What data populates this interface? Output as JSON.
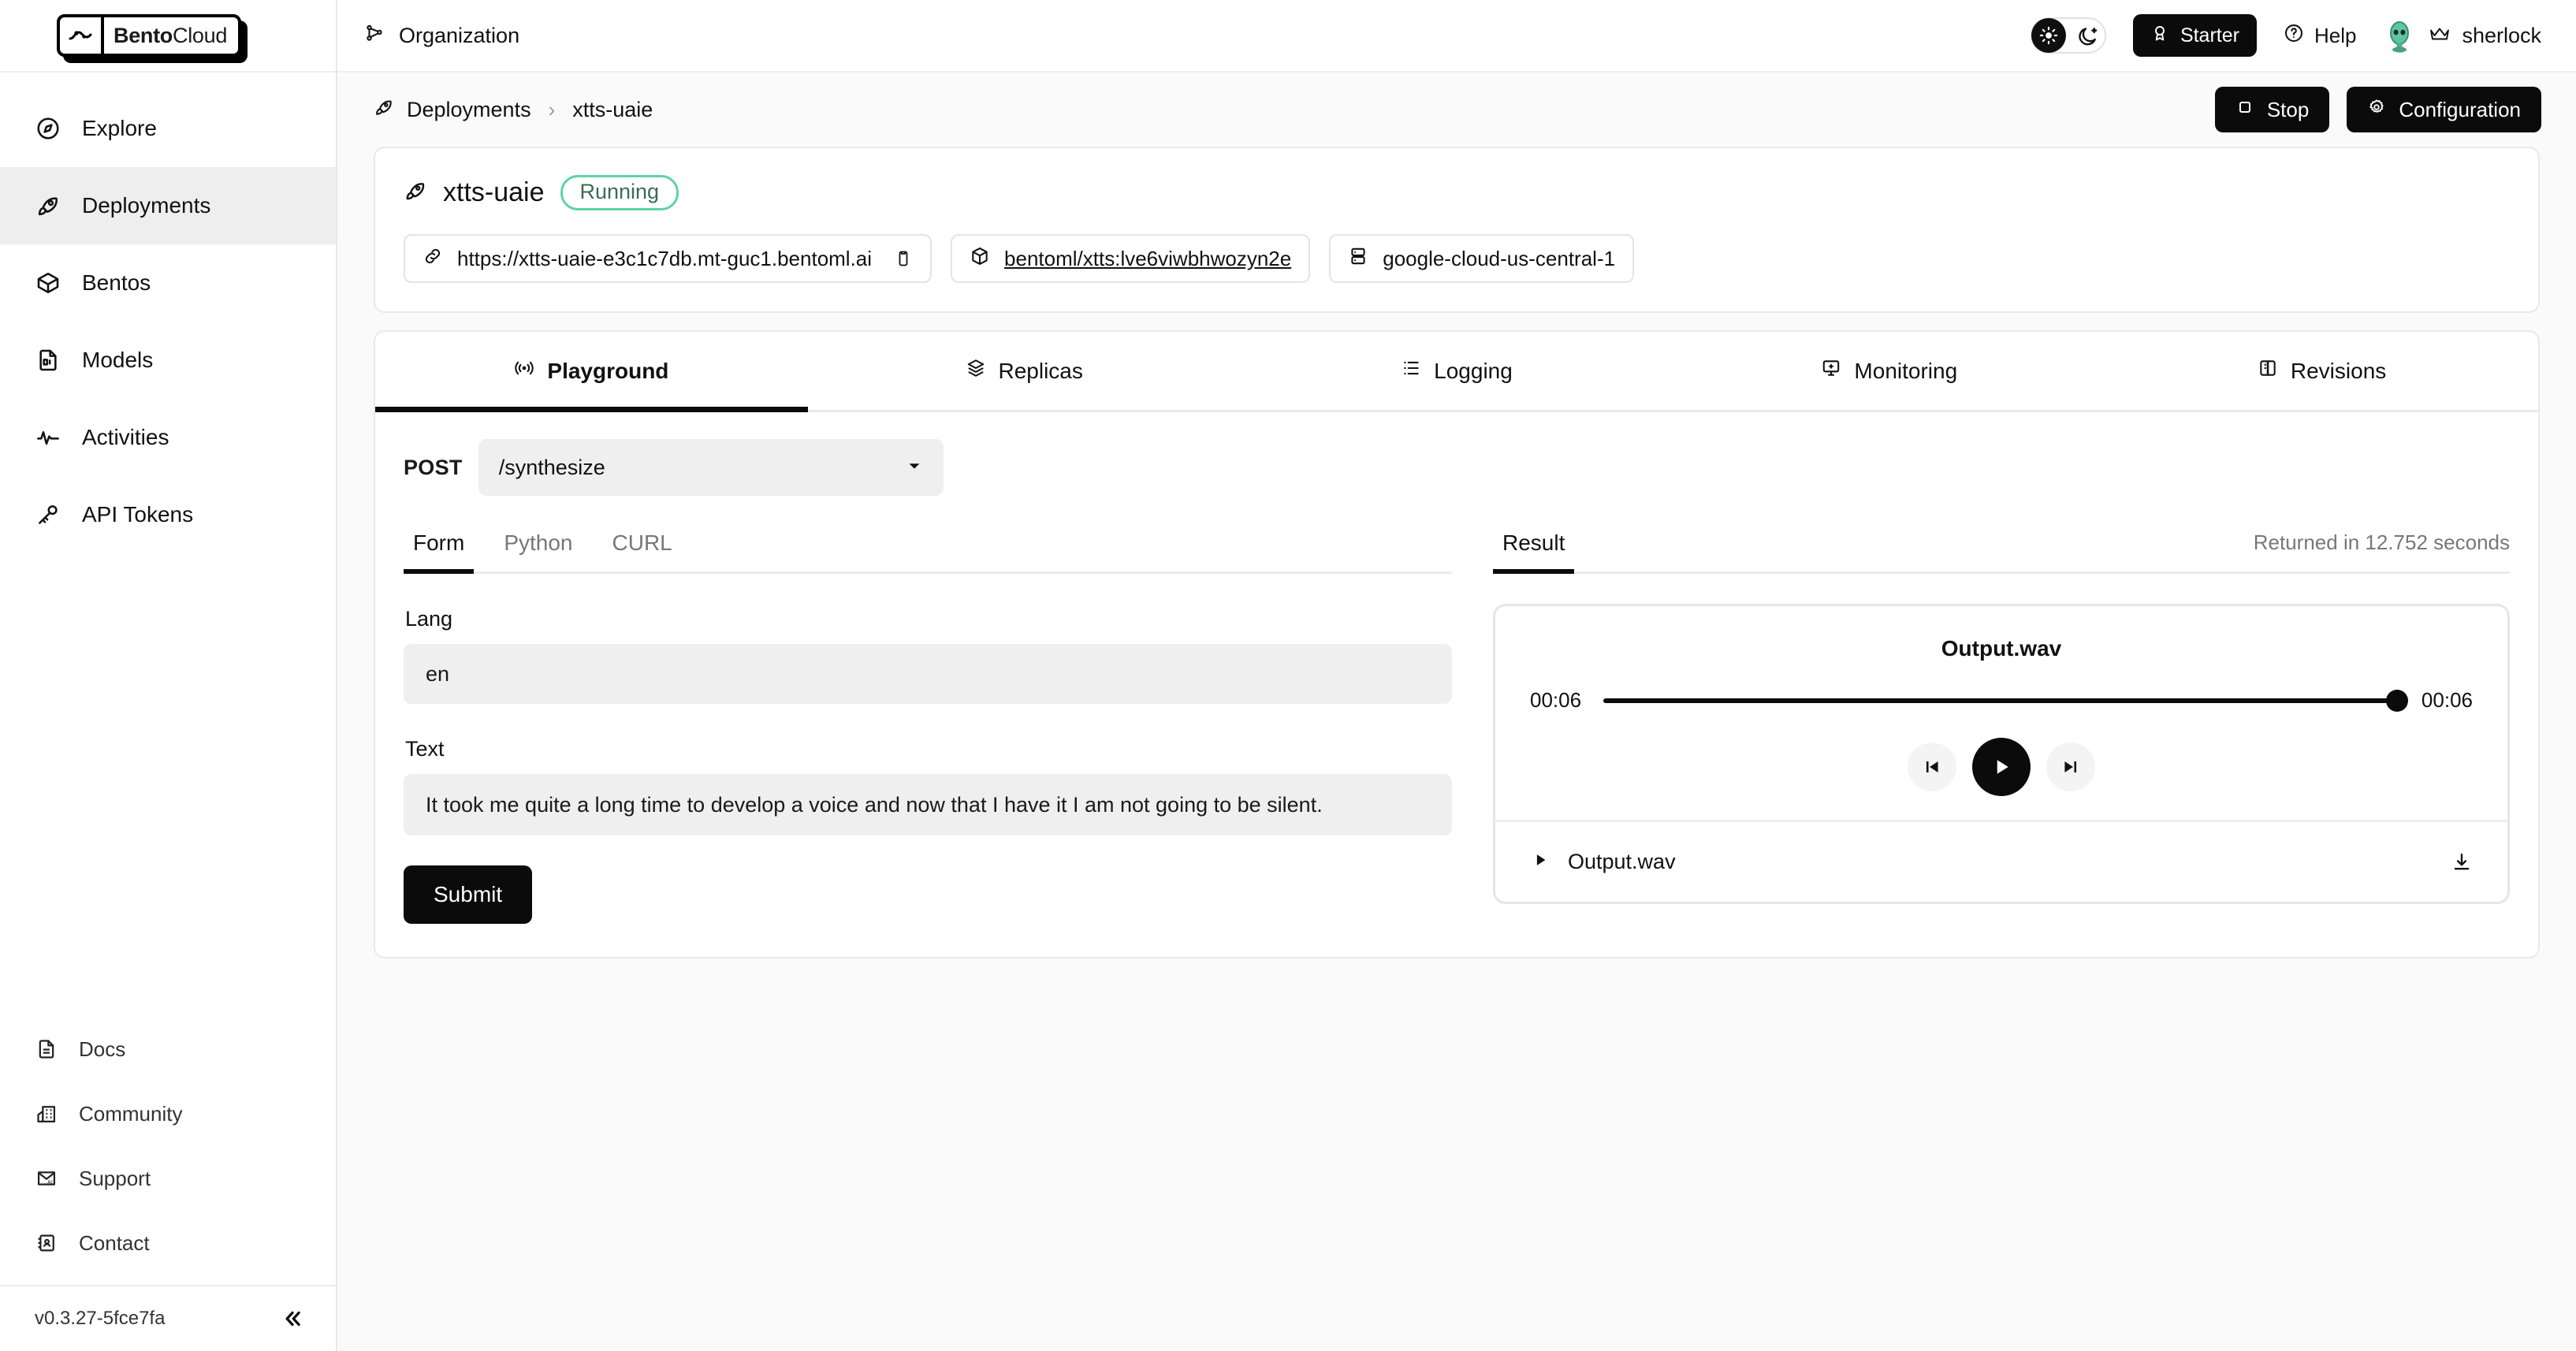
{
  "brand": {
    "name_bold": "Bento",
    "name_light": "Cloud"
  },
  "sidebar": {
    "primary": [
      {
        "label": "Explore",
        "icon": "compass-icon"
      },
      {
        "label": "Deployments",
        "icon": "rocket-icon"
      },
      {
        "label": "Bentos",
        "icon": "box-icon"
      },
      {
        "label": "Models",
        "icon": "model-file-icon"
      },
      {
        "label": "Activities",
        "icon": "pulse-icon"
      },
      {
        "label": "API Tokens",
        "icon": "key-icon"
      }
    ],
    "secondary": [
      {
        "label": "Docs",
        "icon": "document-icon"
      },
      {
        "label": "Community",
        "icon": "community-icon"
      },
      {
        "label": "Support",
        "icon": "support-mail-icon"
      },
      {
        "label": "Contact",
        "icon": "contact-card-icon"
      }
    ],
    "version": "v0.3.27-5fce7fa",
    "collapse_icon": "chevrons-left-icon"
  },
  "topbar": {
    "org_label": "Organization",
    "org_icon": "org-nodes-icon",
    "theme_toggle": {
      "light_icon": "sun-icon",
      "dark_icon": "moon-icon",
      "active": "light"
    },
    "plan": {
      "label": "Starter",
      "icon": "award-icon"
    },
    "help": {
      "label": "Help",
      "icon": "question-circle-icon"
    },
    "user": {
      "name": "sherlock",
      "crown_icon": "crown-icon",
      "avatar_icon": "avatar"
    }
  },
  "breadcrumb": {
    "root": "Deployments",
    "root_icon": "rocket-icon",
    "separator": "›",
    "current": "xtts-uaie"
  },
  "header_actions": {
    "stop": {
      "label": "Stop",
      "icon": "stop-square-icon"
    },
    "configuration": {
      "label": "Configuration",
      "icon": "gear-icon"
    }
  },
  "deployment": {
    "name": "xtts-uaie",
    "name_icon": "rocket-icon",
    "status": "Running",
    "status_color": "#5ed4a0",
    "chips": [
      {
        "icon": "link-icon",
        "text": "https://xtts-uaie-e3c1c7db.mt-guc1.bentoml.ai",
        "trailing_icon": "copy-icon"
      },
      {
        "icon": "bento-box-icon",
        "text": "bentoml/xtts:lve6viwbhwozyn2e",
        "link": true
      },
      {
        "icon": "server-icon",
        "text": "google-cloud-us-central-1"
      }
    ]
  },
  "tabs": [
    {
      "label": "Playground",
      "icon": "broadcast-icon",
      "active": true
    },
    {
      "label": "Replicas",
      "icon": "layers-icon",
      "active": false
    },
    {
      "label": "Logging",
      "icon": "logs-icon",
      "active": false
    },
    {
      "label": "Monitoring",
      "icon": "monitor-icon",
      "active": false
    },
    {
      "label": "Revisions",
      "icon": "revisions-icon",
      "active": false
    }
  ],
  "playground": {
    "method": "POST",
    "endpoint": "/synthesize",
    "endpoint_caret_icon": "chevron-down-icon",
    "request_tabs": [
      {
        "label": "Form",
        "active": true
      },
      {
        "label": "Python",
        "active": false
      },
      {
        "label": "CURL",
        "active": false
      }
    ],
    "fields": [
      {
        "label": "Lang",
        "value": "en"
      },
      {
        "label": "Text",
        "value": "It took me quite a long time to develop a voice and now that I have it I am not going to be silent."
      }
    ],
    "submit_label": "Submit"
  },
  "result": {
    "tab_label": "Result",
    "returned": "Returned in 12.752 seconds",
    "player": {
      "title": "Output.wav",
      "current_time": "00:06",
      "total_time": "00:06",
      "progress_percent": 100,
      "prev_icon": "skip-back-icon",
      "play_icon": "play-icon",
      "next_icon": "skip-forward-icon"
    },
    "file": {
      "name": "Output.wav",
      "expand_icon": "triangle-right-icon",
      "download_icon": "download-icon"
    }
  }
}
